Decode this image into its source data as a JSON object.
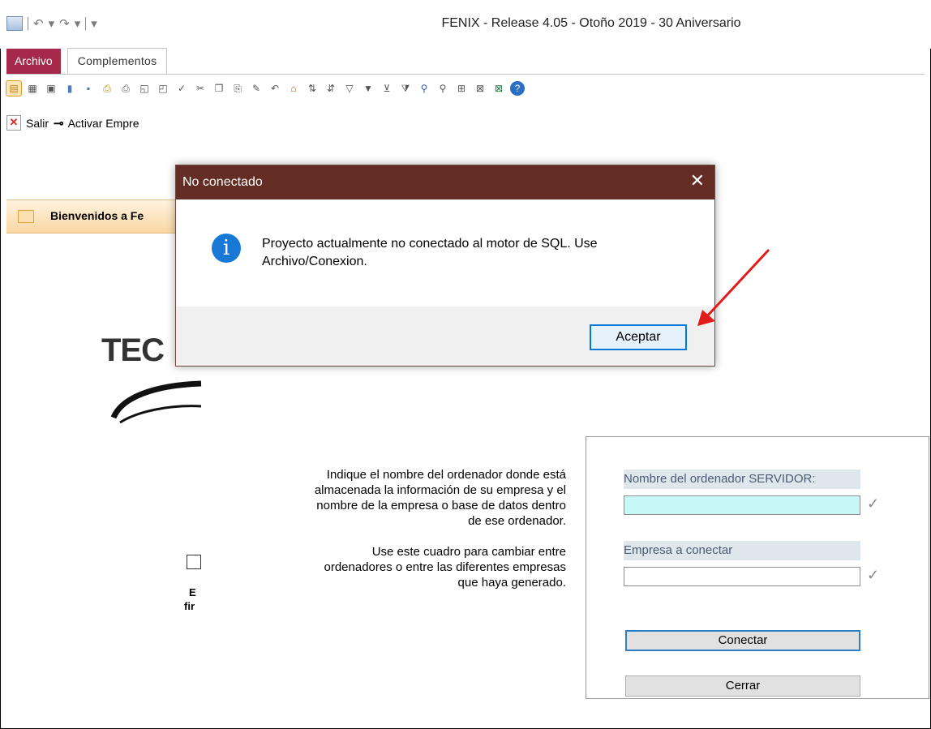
{
  "window": {
    "title": "FENIX - Release 4.05 - Otoño 2019 - 30 Aniversario"
  },
  "qat": {
    "undo": "↶",
    "redo": "↷",
    "customize": "▾"
  },
  "ribbon": {
    "tabs": [
      {
        "label": "Archivo"
      },
      {
        "label": "Complementos"
      }
    ]
  },
  "toolbar2": {
    "salir": "Salir",
    "activar": "Activar Empre"
  },
  "nav": {
    "tab_label": "Bienvenidos a Fe"
  },
  "background": {
    "logo_text": "TEC",
    "trunc1": "E",
    "trunc2": "fir",
    "help_p1": "Indique el nombre del ordenador donde está almacenada la información de su empresa y el nombre de la empresa o base de datos dentro de ese ordenador.",
    "help_p2": "Use este cuadro para cambiar entre ordenadores o entre las diferentes empresas que haya generado."
  },
  "panel": {
    "server_label": "Nombre del ordenador SERVIDOR:",
    "server_value": "",
    "company_label": "Empresa a conectar",
    "company_value": "",
    "connect_button": "Conectar",
    "close_button": "Cerrar"
  },
  "dialog": {
    "title": "No conectado",
    "message": "Proyecto actualmente no conectado al motor de SQL. Use Archivo/Conexion.",
    "ok_button": "Aceptar",
    "close_glyph": "✕"
  },
  "colors": {
    "dialog_title": "#632d24",
    "archivo_tab": "#a6284a",
    "arrow": "#e31b1b",
    "accent": "#0078d7"
  }
}
